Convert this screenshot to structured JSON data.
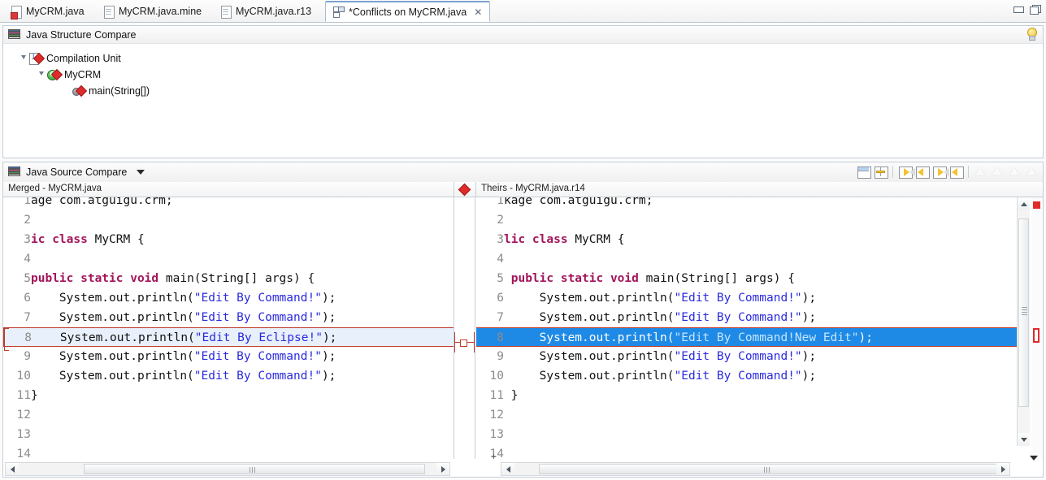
{
  "window": {
    "minimize_label": "Minimize",
    "maximize_label": "Maximize"
  },
  "tabs": [
    {
      "label": "MyCRM.java",
      "icon": "java-class-conflict-icon",
      "active": false,
      "dirty": false
    },
    {
      "label": "MyCRM.java.mine",
      "icon": "file-icon",
      "active": false,
      "dirty": false
    },
    {
      "label": "MyCRM.java.r13",
      "icon": "file-icon",
      "active": false,
      "dirty": false
    },
    {
      "label": "*Conflicts on MyCRM.java",
      "icon": "compare-editor-icon",
      "active": true,
      "dirty": true,
      "close": "✕"
    }
  ],
  "structure_compare": {
    "title": "Java Structure Compare",
    "icon": "java-structure-compare-icon",
    "hint_icon": "lightbulb-icon",
    "tree": [
      {
        "label": "Compilation Unit",
        "icon": "compilation-unit-icon",
        "indent": 0,
        "expanded": true,
        "conflict": true
      },
      {
        "label": "MyCRM",
        "icon": "class-icon",
        "indent": 1,
        "expanded": true,
        "conflict": true
      },
      {
        "label": "main(String[])",
        "icon": "method-icon",
        "indent": 2,
        "expanded": null,
        "conflict": true
      }
    ]
  },
  "source_compare": {
    "title": "Java Source Compare",
    "icon": "java-source-compare-icon",
    "menu_icon": "chevron-down-icon",
    "toolbar": [
      {
        "name": "two-pane-layout-button",
        "icon": "two-pane-icon",
        "enabled": true
      },
      {
        "name": "three-pane-layout-button",
        "icon": "three-pane-icon",
        "enabled": true
      },
      {
        "name": "copy-all-left-to-right-button",
        "icon": "copy-all-right-icon",
        "enabled": true
      },
      {
        "name": "copy-current-to-left-button",
        "icon": "copy-left-icon",
        "enabled": true
      },
      {
        "name": "copy-current-to-right-button",
        "icon": "copy-right-icon",
        "enabled": true
      },
      {
        "name": "copy-from-right-button",
        "icon": "copy-left-filled-icon",
        "enabled": true
      },
      {
        "name": "next-difference-button",
        "icon": "next-diff-icon",
        "enabled": false
      },
      {
        "name": "previous-difference-button",
        "icon": "prev-diff-icon",
        "enabled": false
      },
      {
        "name": "next-change-button",
        "icon": "next-change-icon",
        "enabled": false
      },
      {
        "name": "previous-change-button",
        "icon": "prev-change-icon",
        "enabled": false
      }
    ],
    "left_pane": {
      "header": "Merged - MyCRM.java",
      "scrolled_horizontally": true,
      "lines": [
        {
          "num": "1",
          "conflict": false,
          "selected": false,
          "tokens": [
            {
              "t": "age com.atguigu.crm;",
              "c": "pl"
            }
          ]
        },
        {
          "num": "2",
          "conflict": false,
          "selected": false,
          "tokens": []
        },
        {
          "num": "3",
          "conflict": false,
          "selected": false,
          "tokens": [
            {
              "t": "ic ",
              "c": "kw"
            },
            {
              "t": "class ",
              "c": "kw"
            },
            {
              "t": "MyCRM {",
              "c": "pl"
            }
          ]
        },
        {
          "num": "4",
          "conflict": false,
          "selected": false,
          "tokens": []
        },
        {
          "num": "5",
          "conflict": false,
          "selected": false,
          "tokens": [
            {
              "t": "public static void ",
              "c": "kw"
            },
            {
              "t": "main(String[] args) {",
              "c": "pl"
            }
          ]
        },
        {
          "num": "6",
          "conflict": false,
          "selected": false,
          "tokens": [
            {
              "t": "    System.out.println(",
              "c": "pl"
            },
            {
              "t": "\"Edit By Command!\"",
              "c": "str"
            },
            {
              "t": ");",
              "c": "pl"
            }
          ]
        },
        {
          "num": "7",
          "conflict": false,
          "selected": false,
          "tokens": [
            {
              "t": "    System.out.println(",
              "c": "pl"
            },
            {
              "t": "\"Edit By Command!\"",
              "c": "str"
            },
            {
              "t": ");",
              "c": "pl"
            }
          ]
        },
        {
          "num": "8",
          "conflict": true,
          "selected": false,
          "tokens": [
            {
              "t": "    System.out.println(",
              "c": "pl"
            },
            {
              "t": "\"Edit By Eclipse!\"",
              "c": "str"
            },
            {
              "t": ");",
              "c": "pl"
            }
          ]
        },
        {
          "num": "9",
          "conflict": false,
          "selected": false,
          "tokens": [
            {
              "t": "    System.out.println(",
              "c": "pl"
            },
            {
              "t": "\"Edit By Command!\"",
              "c": "str"
            },
            {
              "t": ");",
              "c": "pl"
            }
          ]
        },
        {
          "num": "10",
          "conflict": false,
          "selected": false,
          "tokens": [
            {
              "t": "    System.out.println(",
              "c": "pl"
            },
            {
              "t": "\"Edit By Command!\"",
              "c": "str"
            },
            {
              "t": ");",
              "c": "pl"
            }
          ]
        },
        {
          "num": "11",
          "conflict": false,
          "selected": false,
          "tokens": [
            {
              "t": "}",
              "c": "pl"
            }
          ]
        },
        {
          "num": "12",
          "conflict": false,
          "selected": false,
          "tokens": []
        },
        {
          "num": "13",
          "conflict": false,
          "selected": false,
          "tokens": []
        },
        {
          "num": "14",
          "conflict": false,
          "selected": false,
          "tokens": []
        }
      ]
    },
    "right_pane": {
      "header": "Theirs - MyCRM.java.r14",
      "scrolled_horizontally": true,
      "lines": [
        {
          "num": "1",
          "conflict": false,
          "selected": false,
          "tokens": [
            {
              "t": "kage com.atguigu.crm;",
              "c": "pl"
            }
          ]
        },
        {
          "num": "2",
          "conflict": false,
          "selected": false,
          "tokens": []
        },
        {
          "num": "3",
          "conflict": false,
          "selected": false,
          "tokens": [
            {
              "t": "lic ",
              "c": "kw"
            },
            {
              "t": "class ",
              "c": "kw"
            },
            {
              "t": "MyCRM {",
              "c": "pl"
            }
          ]
        },
        {
          "num": "4",
          "conflict": false,
          "selected": false,
          "tokens": []
        },
        {
          "num": "5",
          "conflict": false,
          "selected": false,
          "tokens": [
            {
              "t": " ",
              "c": "pl"
            },
            {
              "t": "public static void ",
              "c": "kw"
            },
            {
              "t": "main(String[] args) {",
              "c": "pl"
            }
          ]
        },
        {
          "num": "6",
          "conflict": false,
          "selected": false,
          "tokens": [
            {
              "t": "     System.out.println(",
              "c": "pl"
            },
            {
              "t": "\"Edit By Command!\"",
              "c": "str"
            },
            {
              "t": ");",
              "c": "pl"
            }
          ]
        },
        {
          "num": "7",
          "conflict": false,
          "selected": false,
          "tokens": [
            {
              "t": "     System.out.println(",
              "c": "pl"
            },
            {
              "t": "\"Edit By Command!\"",
              "c": "str"
            },
            {
              "t": ");",
              "c": "pl"
            }
          ]
        },
        {
          "num": "8",
          "conflict": true,
          "selected": true,
          "tokens": [
            {
              "t": "     System.out.println(",
              "c": "pl"
            },
            {
              "t": "\"Edit By Command!New Edit\"",
              "c": "str"
            },
            {
              "t": ");",
              "c": "pl"
            }
          ]
        },
        {
          "num": "9",
          "conflict": false,
          "selected": false,
          "tokens": [
            {
              "t": "     System.out.println(",
              "c": "pl"
            },
            {
              "t": "\"Edit By Command!\"",
              "c": "str"
            },
            {
              "t": ");",
              "c": "pl"
            }
          ]
        },
        {
          "num": "10",
          "conflict": false,
          "selected": false,
          "tokens": [
            {
              "t": "     System.out.println(",
              "c": "pl"
            },
            {
              "t": "\"Edit By Command!\"",
              "c": "str"
            },
            {
              "t": ");",
              "c": "pl"
            }
          ]
        },
        {
          "num": "11",
          "conflict": false,
          "selected": false,
          "tokens": [
            {
              "t": " }",
              "c": "pl"
            }
          ]
        },
        {
          "num": "12",
          "conflict": false,
          "selected": false,
          "tokens": []
        },
        {
          "num": "13",
          "conflict": false,
          "selected": false,
          "tokens": []
        },
        {
          "num": "14",
          "conflict": false,
          "selected": false,
          "tokens": []
        }
      ]
    },
    "conflict_marker_icon": "conflict-diamond-icon"
  },
  "colors": {
    "conflict_border": "#c0392b",
    "conflict_fill": "#e8f0fb",
    "selection": "#1e8ae6",
    "string_literal": "#2a2ae0",
    "keyword": "#a2145a",
    "line_number": "#8c8c8c",
    "marker_red": "#e02b2b"
  }
}
